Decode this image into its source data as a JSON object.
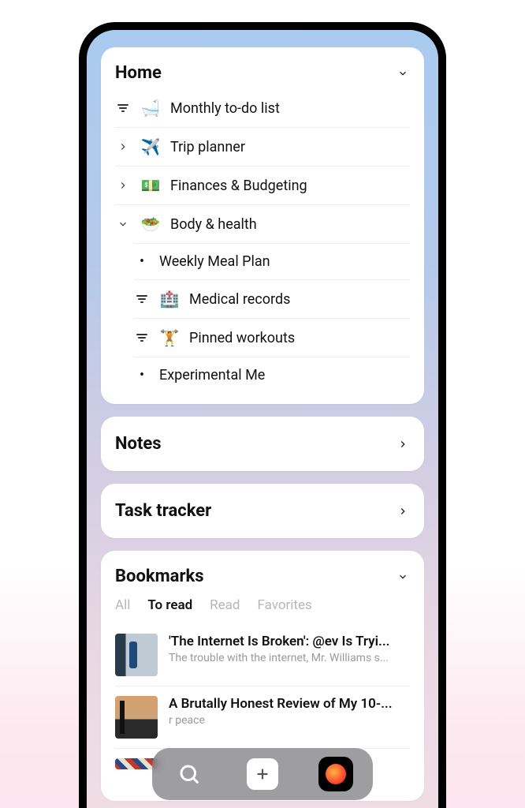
{
  "home": {
    "title": "Home",
    "items": [
      {
        "lead": "filter",
        "emoji": "🛁",
        "label": "Monthly to-do list"
      },
      {
        "lead": "right",
        "emoji": "✈️",
        "label": "Trip planner"
      },
      {
        "lead": "right",
        "emoji": "💵",
        "label": "Finances & Budgeting"
      },
      {
        "lead": "down",
        "emoji": "🥗",
        "label": "Body & health"
      }
    ],
    "sub": [
      {
        "lead": "bullet",
        "emoji": "",
        "label": "Weekly Meal Plan"
      },
      {
        "lead": "filter",
        "emoji": "🏥",
        "label": "Medical records"
      },
      {
        "lead": "filter",
        "emoji": "🏋️",
        "label": "Pinned workouts"
      },
      {
        "lead": "bullet",
        "emoji": "",
        "label": "Experimental Me"
      }
    ]
  },
  "notes": {
    "title": "Notes"
  },
  "tasks": {
    "title": "Task tracker"
  },
  "bookmarks": {
    "title": "Bookmarks",
    "tabs": {
      "all": "All",
      "toread": "To read",
      "read": "Read",
      "fav": "Favorites",
      "active": "toread"
    },
    "items": [
      {
        "title": "'The Internet Is Broken': @ev Is Tryi...",
        "sub": "The trouble with the internet, Mr. Williams s..."
      },
      {
        "title": "A Brutally Honest Review of My 10-...",
        "sub": "r peace"
      }
    ]
  }
}
